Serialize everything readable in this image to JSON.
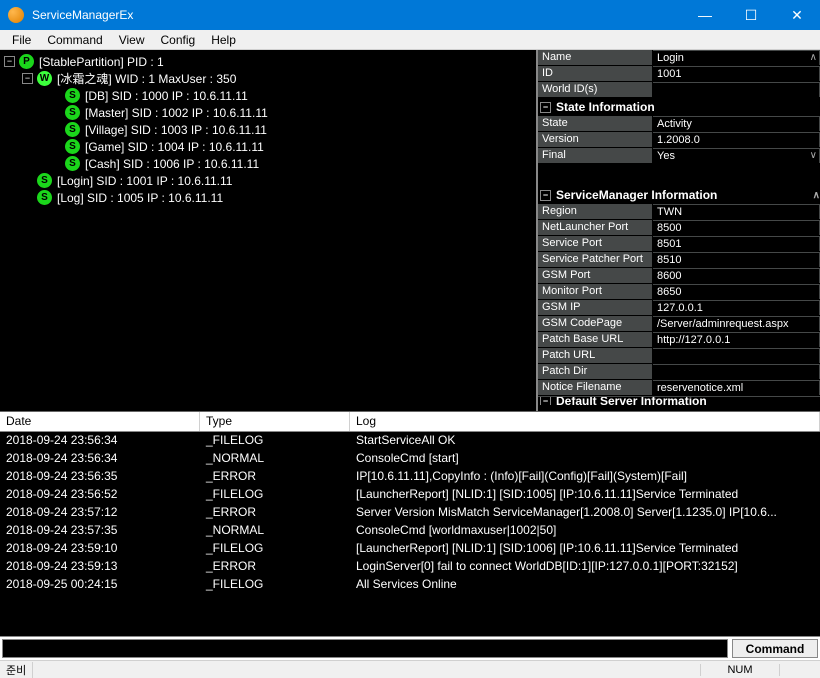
{
  "window": {
    "title": "ServiceManagerEx",
    "min": "—",
    "max": "☐",
    "close": "✕"
  },
  "menu": {
    "file": "File",
    "command": "Command",
    "view": "View",
    "config": "Config",
    "help": "Help"
  },
  "tree": {
    "root": "[StablePartition] PID : 1",
    "world": "[冰霜之魂] WID : 1 MaxUser : 350",
    "nodes": [
      "[DB] SID : 1000 IP : 10.6.11.11",
      "[Master] SID : 1002 IP : 10.6.11.11",
      "[Village] SID : 1003 IP : 10.6.11.11",
      "[Game] SID : 1004 IP : 10.6.11.11",
      "[Cash] SID : 1006 IP : 10.6.11.11"
    ],
    "login": "[Login] SID : 1001 IP : 10.6.11.11",
    "log": "[Log] SID : 1005 IP : 10.6.11.11"
  },
  "panel1": {
    "rows": [
      {
        "k": "Name",
        "v": "Login"
      },
      {
        "k": "ID",
        "v": "1001"
      },
      {
        "k": "World ID(s)",
        "v": ""
      }
    ]
  },
  "stateinfo": {
    "title": "State Information",
    "rows": [
      {
        "k": "State",
        "v": "Activity"
      },
      {
        "k": "Version",
        "v": "1.2008.0"
      },
      {
        "k": "Final",
        "v": "Yes"
      }
    ]
  },
  "sminfo": {
    "title": "ServiceManager Information",
    "rows": [
      {
        "k": "Region",
        "v": "TWN"
      },
      {
        "k": "NetLauncher Port",
        "v": "8500"
      },
      {
        "k": "Service Port",
        "v": "8501"
      },
      {
        "k": "Service Patcher Port",
        "v": "8510"
      },
      {
        "k": "GSM Port",
        "v": "8600"
      },
      {
        "k": "Monitor Port",
        "v": "8650"
      },
      {
        "k": "GSM IP",
        "v": "127.0.0.1"
      },
      {
        "k": "GSM CodePage",
        "v": "/Server/adminrequest.aspx"
      },
      {
        "k": "Patch Base URL",
        "v": "http://127.0.0.1"
      },
      {
        "k": "Patch URL",
        "v": ""
      },
      {
        "k": "Patch Dir",
        "v": ""
      },
      {
        "k": "Notice Filename",
        "v": "reservenotice.xml"
      }
    ]
  },
  "defsrv": {
    "title": "Default Server Information"
  },
  "logtable": {
    "headers": {
      "date": "Date",
      "type": "Type",
      "log": "Log"
    },
    "rows": [
      {
        "d": "2018-09-24 23:56:34",
        "t": "_FILELOG",
        "l": "StartServiceAll OK"
      },
      {
        "d": "2018-09-24 23:56:34",
        "t": "_NORMAL",
        "l": "ConsoleCmd [start]"
      },
      {
        "d": "2018-09-24 23:56:35",
        "t": "_ERROR",
        "l": "IP[10.6.11.11],CopyInfo : (Info)[Fail](Config)[Fail](System)[Fail]"
      },
      {
        "d": "2018-09-24 23:56:52",
        "t": "_FILELOG",
        "l": "[LauncherReport] [NLID:1] [SID:1005] [IP:10.6.11.11]Service Terminated"
      },
      {
        "d": "2018-09-24 23:57:12",
        "t": "_ERROR",
        "l": "Server Version MisMatch ServiceManager[1.2008.0] Server[1.1235.0] IP[10.6..."
      },
      {
        "d": "2018-09-24 23:57:35",
        "t": "_NORMAL",
        "l": "ConsoleCmd [worldmaxuser|1002|50]"
      },
      {
        "d": "2018-09-24 23:59:10",
        "t": "_FILELOG",
        "l": "[LauncherReport] [NLID:1] [SID:1006] [IP:10.6.11.11]Service Terminated"
      },
      {
        "d": "2018-09-24 23:59:13",
        "t": "_ERROR",
        "l": "LoginServer[0] fail to connect WorldDB[ID:1][IP:127.0.0.1][PORT:32152]"
      },
      {
        "d": "2018-09-25 00:24:15",
        "t": "_FILELOG",
        "l": "All Services Online"
      }
    ]
  },
  "cmd": {
    "button": "Command",
    "value": ""
  },
  "status": {
    "ready": "준비",
    "num": "NUM"
  }
}
